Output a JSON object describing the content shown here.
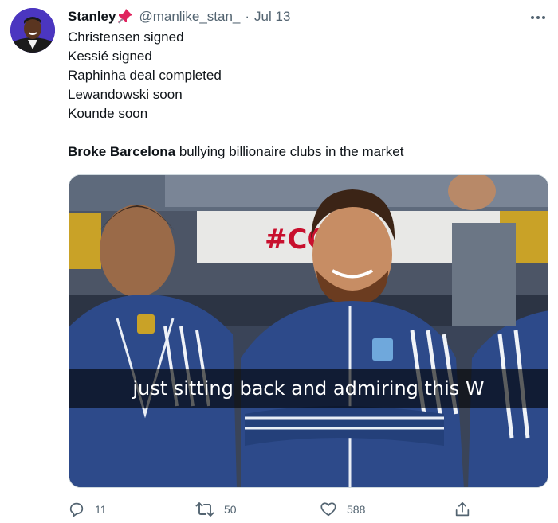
{
  "tweet": {
    "display_name": "Stanley",
    "handle": "@manlike_stan_",
    "separator": "·",
    "date": "Jul 13",
    "lines": [
      "Christensen signed",
      "Kessié signed",
      "Raphinha deal completed",
      "Lewandowski soon",
      "Kounde soon"
    ],
    "closing_bold": "Broke Barcelona",
    "closing_rest": " bullying billionaire clubs in the market"
  },
  "media": {
    "caption": "just sitting back and admiring this W",
    "banner_text": "#CO    00"
  },
  "actions": {
    "replies": "11",
    "retweets": "50",
    "likes": "588"
  },
  "colors": {
    "secondary_text": "#536471",
    "primary_text": "#0f1419",
    "jersey_blue": "#2d4a8a",
    "pin_red": "#e0245e"
  }
}
